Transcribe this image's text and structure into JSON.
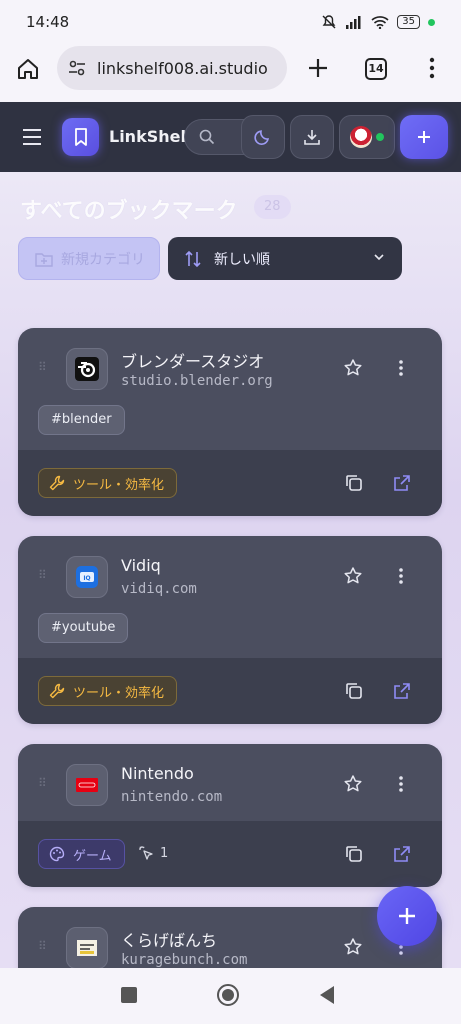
{
  "status_bar": {
    "time": "14:48",
    "battery": "35"
  },
  "browser": {
    "url": "linkshelf008.ai.studio",
    "tab_count": "14"
  },
  "header": {
    "app_title": "LinkShelf"
  },
  "main": {
    "title": "すべてのブックマーク",
    "count": "28",
    "new_category_label": "新規カテゴリ",
    "sort_label": "新しい順"
  },
  "cards": [
    {
      "name": "ブレンダースタジオ",
      "domain": "studio.blender.org",
      "tag": "#blender",
      "category": "ツール・効率化"
    },
    {
      "name": "Vidiq",
      "domain": "vidiq.com",
      "tag": "#youtube",
      "category": "ツール・効率化"
    },
    {
      "name": "Nintendo",
      "domain": "nintendo.com",
      "category": "ゲーム",
      "clicks": "1"
    },
    {
      "name": "くらげばんち",
      "domain": "kuragebunch.com"
    }
  ],
  "colors": {
    "accent": "#5b52e6",
    "header_bg": "#2f3241",
    "card_bg": "#4b4e5f",
    "tool_badge": "#f5b942",
    "game_badge": "#b6aef8"
  }
}
